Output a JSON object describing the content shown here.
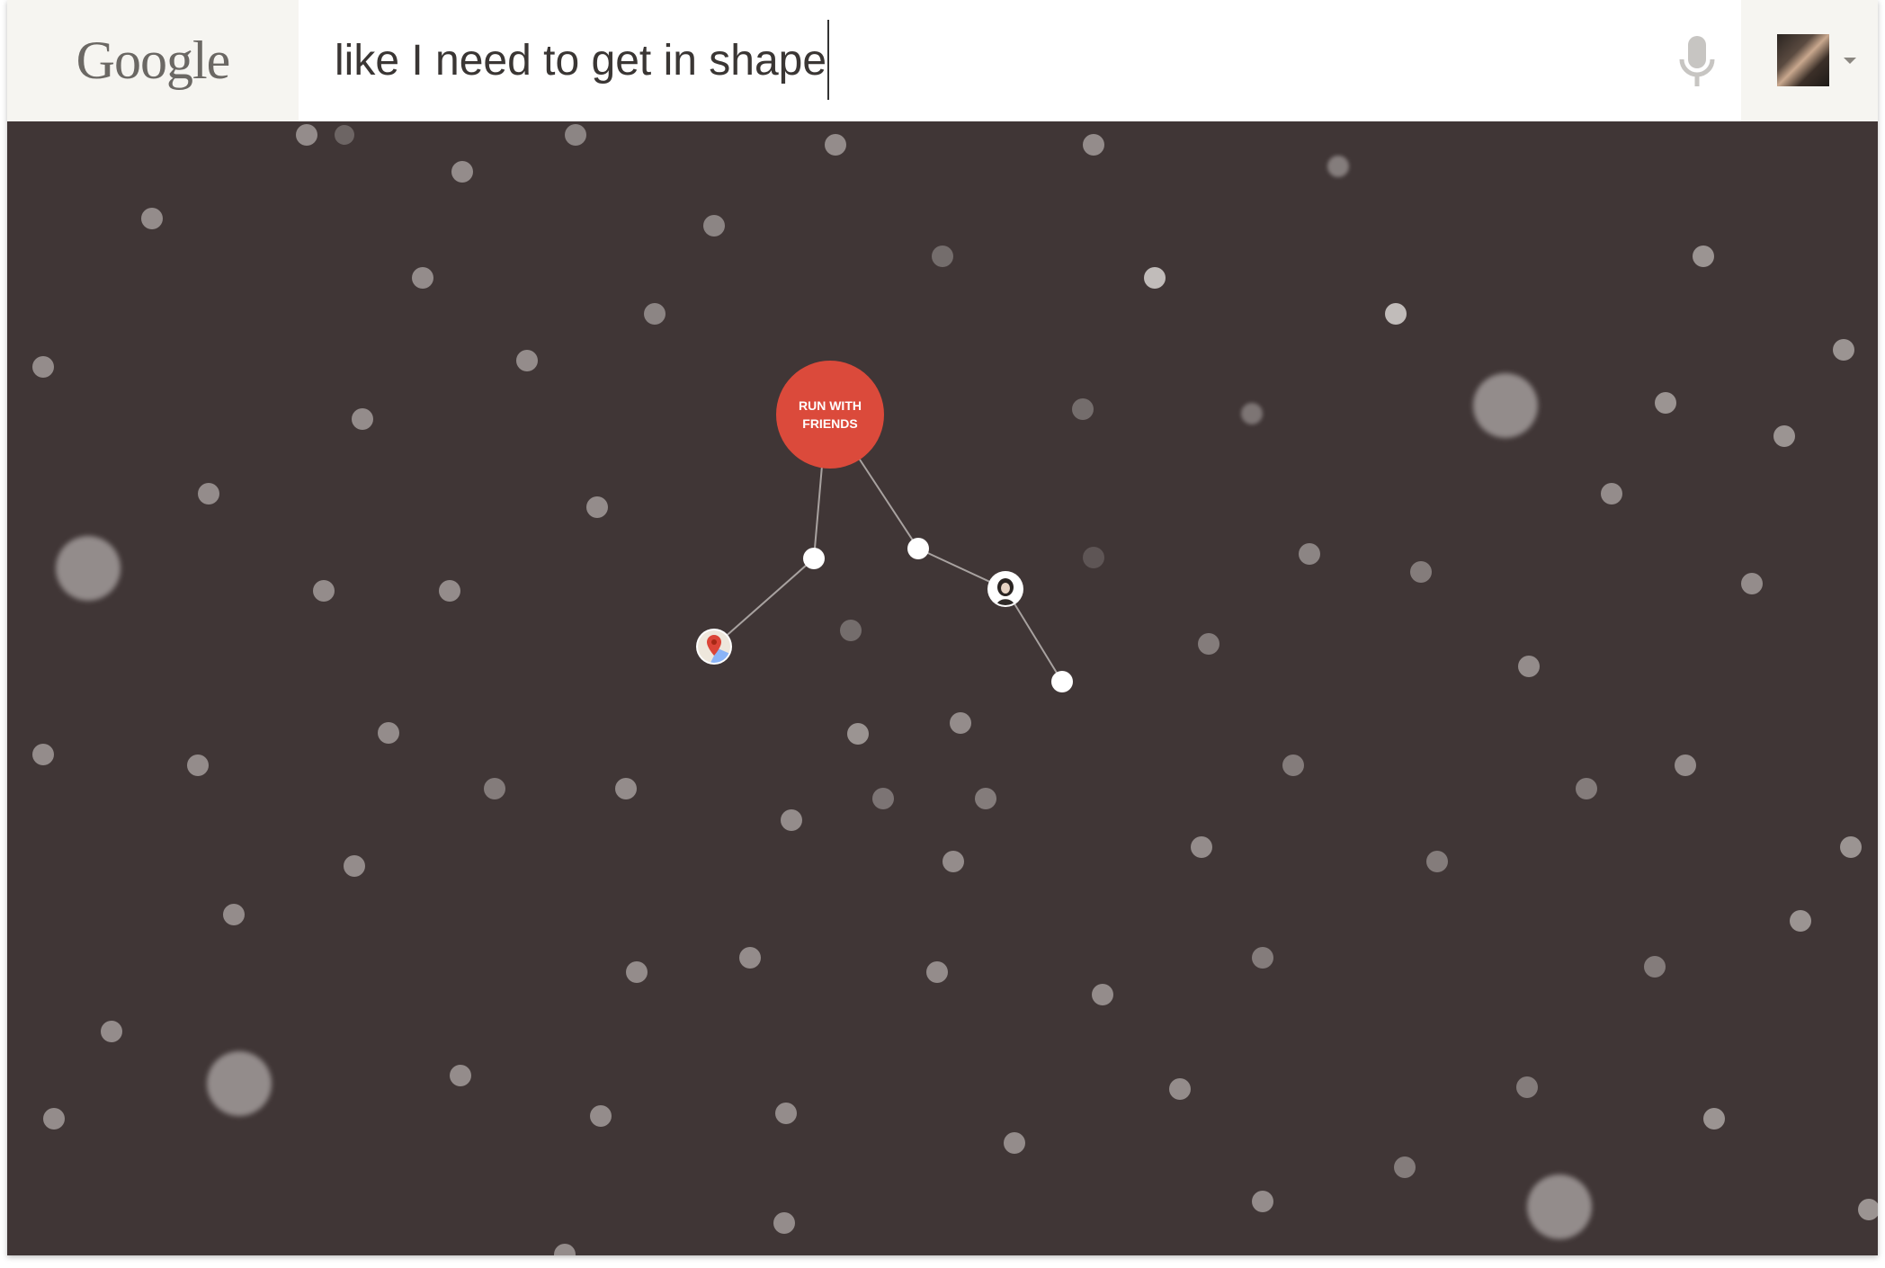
{
  "header": {
    "logo": "Google",
    "search": {
      "query": "like I need to get in shape",
      "placeholder": ""
    },
    "icons": {
      "mic": "microphone-icon",
      "avatar": "user-avatar",
      "menu": "dropdown-caret-icon"
    }
  },
  "graph": {
    "center": {
      "line1": "RUN WITH",
      "line2": "FRIENDS"
    },
    "nodes": [
      {
        "name": "maps-icon",
        "kind": "icon"
      },
      {
        "name": "friend-avatar",
        "kind": "icon"
      }
    ]
  },
  "colors": {
    "background": "#403636",
    "accent": "#db4a3b",
    "node": "#ffffff",
    "dot": "#8e8787"
  }
}
